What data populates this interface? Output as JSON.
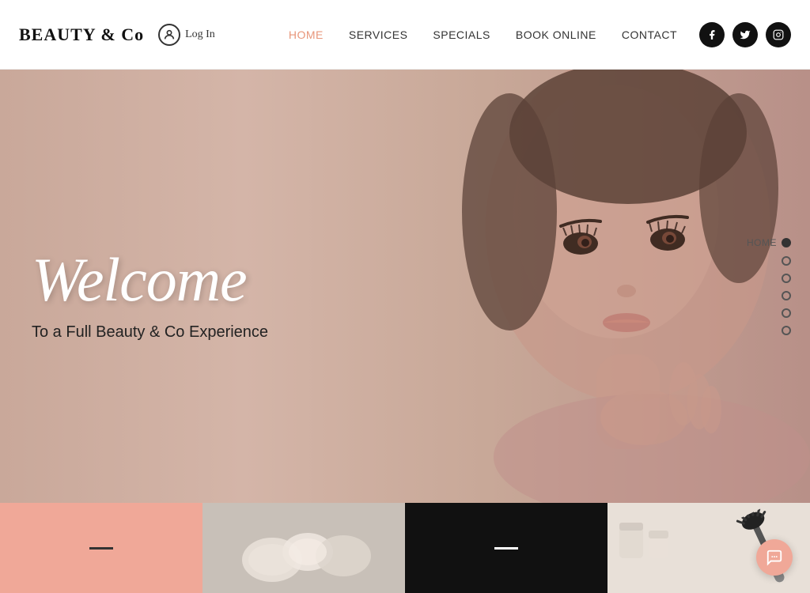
{
  "header": {
    "logo": "BEAUTY & Co",
    "login_label": "Log In",
    "nav": [
      {
        "label": "HOME",
        "active": true
      },
      {
        "label": "SERVICES",
        "active": false
      },
      {
        "label": "SPECIALS",
        "active": false
      },
      {
        "label": "BOOK ONLINE",
        "active": false
      },
      {
        "label": "CONTACT",
        "active": false
      }
    ],
    "social": [
      {
        "name": "facebook",
        "symbol": "f"
      },
      {
        "name": "twitter",
        "symbol": "t"
      },
      {
        "name": "instagram",
        "symbol": "in"
      }
    ]
  },
  "hero": {
    "welcome_text": "Welcome",
    "subtitle": "To a Full Beauty & Co Experience",
    "scroll_label": "HOME",
    "dots_count": 6
  },
  "bottom_strip": {
    "items": [
      {
        "bg": "#f0a898",
        "type": "dash"
      },
      {
        "bg": "#c8c0b8",
        "type": "circles"
      },
      {
        "bg": "#111",
        "type": "dash_light"
      },
      {
        "bg": "#e8e0d8",
        "type": "mascara"
      }
    ]
  },
  "chat": {
    "symbol": "···"
  }
}
